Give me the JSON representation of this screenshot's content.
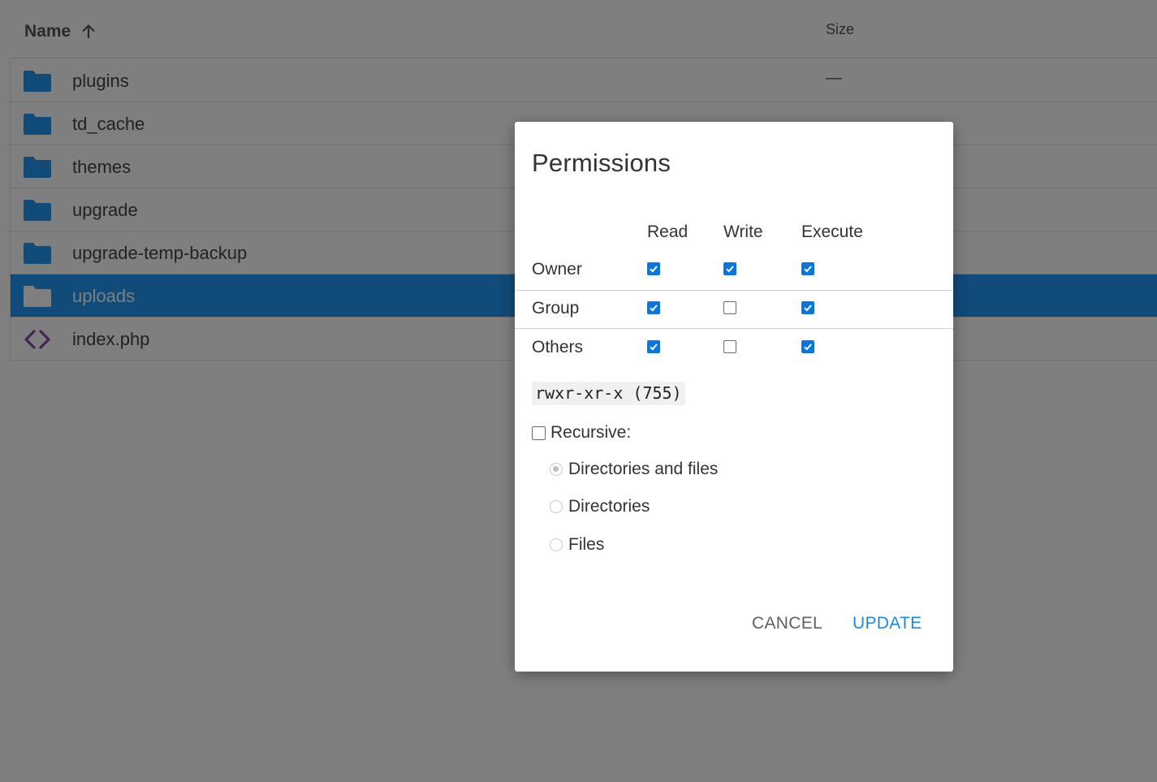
{
  "listing": {
    "columns": {
      "name": "Name",
      "size": "Size"
    },
    "rows": [
      {
        "name": "plugins",
        "type": "folder",
        "size": "—"
      },
      {
        "name": "td_cache",
        "type": "folder",
        "size": ""
      },
      {
        "name": "themes",
        "type": "folder",
        "size": ""
      },
      {
        "name": "upgrade",
        "type": "folder",
        "size": ""
      },
      {
        "name": "upgrade-temp-backup",
        "type": "folder",
        "size": ""
      },
      {
        "name": "uploads",
        "type": "folder",
        "size": "",
        "selected": true
      },
      {
        "name": "index.php",
        "type": "code",
        "size": ""
      }
    ]
  },
  "dialog": {
    "title": "Permissions",
    "columns": {
      "read": "Read",
      "write": "Write",
      "execute": "Execute"
    },
    "rows": [
      {
        "label": "Owner",
        "read": true,
        "write": true,
        "execute": true
      },
      {
        "label": "Group",
        "read": true,
        "write": false,
        "execute": true
      },
      {
        "label": "Others",
        "read": true,
        "write": false,
        "execute": true
      }
    ],
    "octal": "rwxr-xr-x (755)",
    "recursive_label": "Recursive:",
    "recursive_checked": false,
    "options": [
      {
        "label": "Directories and files",
        "selected": true
      },
      {
        "label": "Directories",
        "selected": false
      },
      {
        "label": "Files",
        "selected": false
      }
    ],
    "cancel_label": "CANCEL",
    "update_label": "UPDATE"
  },
  "colors": {
    "folder": "#2196f3",
    "selected_row": "#2196f3",
    "code_icon": "#8e44ad",
    "checkbox": "#0b74de",
    "primary_button": "#1e88e5"
  }
}
